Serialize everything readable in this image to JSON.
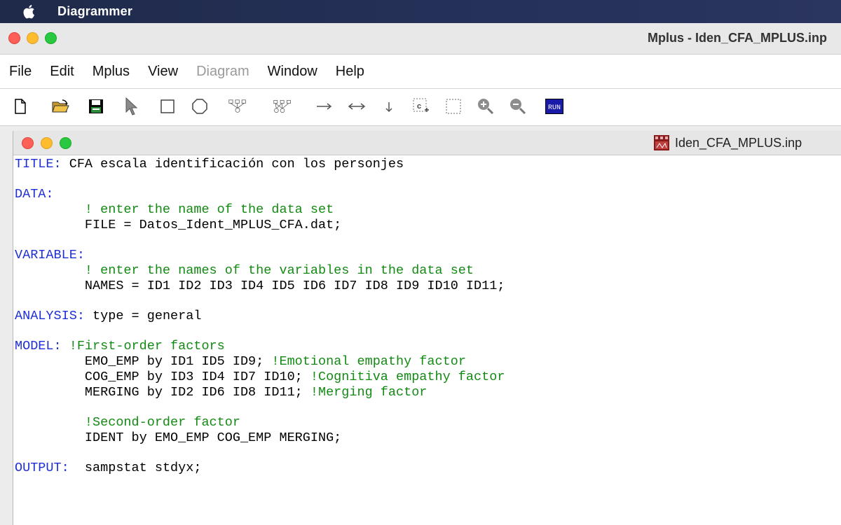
{
  "system_menubar": {
    "app_name": "Diagrammer"
  },
  "window": {
    "title": "Mplus - Iden_CFA_MPLUS.inp",
    "menu": [
      {
        "label": "File",
        "enabled": true
      },
      {
        "label": "Edit",
        "enabled": true
      },
      {
        "label": "Mplus",
        "enabled": true
      },
      {
        "label": "View",
        "enabled": true
      },
      {
        "label": "Diagram",
        "enabled": false
      },
      {
        "label": "Window",
        "enabled": true
      },
      {
        "label": "Help",
        "enabled": true
      }
    ],
    "toolbar": {
      "run_label": "RUN",
      "icons": [
        "new-file-icon",
        "open-folder-icon",
        "save-icon",
        "pointer-icon",
        "rectangle-icon",
        "circle-icon",
        "diagram-tree-icon",
        "diagram-cross-icon",
        "arrow-right-icon",
        "arrow-both-icon",
        "arrow-down-icon",
        "covariance-select-icon",
        "marquee-select-icon",
        "zoom-in-icon",
        "zoom-out-icon",
        "run-icon"
      ]
    }
  },
  "document": {
    "filename": "Iden_CFA_MPLUS.inp",
    "lines": [
      [
        {
          "t": "kw",
          "v": "TITLE:"
        },
        {
          "t": "tx",
          "v": " CFA escala identificación con los personjes"
        }
      ],
      [],
      [
        {
          "t": "kw",
          "v": "DATA:"
        }
      ],
      [
        {
          "t": "cm",
          "v": "         ! enter the name of the data set"
        }
      ],
      [
        {
          "t": "tx",
          "v": "         FILE = Datos_Ident_MPLUS_CFA.dat;"
        }
      ],
      [],
      [
        {
          "t": "kw",
          "v": "VARIABLE:"
        }
      ],
      [
        {
          "t": "cm",
          "v": "         ! enter the names of the variables in the data set"
        }
      ],
      [
        {
          "t": "tx",
          "v": "         NAMES = ID1 ID2 ID3 ID4 ID5 ID6 ID7 ID8 ID9 ID10 ID11;"
        }
      ],
      [],
      [
        {
          "t": "kw",
          "v": "ANALYSIS:"
        },
        {
          "t": "tx",
          "v": " type = general"
        }
      ],
      [],
      [
        {
          "t": "kw",
          "v": "MODEL:"
        },
        {
          "t": "cm",
          "v": " !First-order factors"
        }
      ],
      [
        {
          "t": "tx",
          "v": "         EMO_EMP by ID1 ID5 ID9; "
        },
        {
          "t": "cm",
          "v": "!Emotional empathy factor"
        }
      ],
      [
        {
          "t": "tx",
          "v": "         COG_EMP by ID3 ID4 ID7 ID10; "
        },
        {
          "t": "cm",
          "v": "!Cognitiva empathy factor"
        }
      ],
      [
        {
          "t": "tx",
          "v": "         MERGING by ID2 ID6 ID8 ID11; "
        },
        {
          "t": "cm",
          "v": "!Merging factor"
        }
      ],
      [],
      [
        {
          "t": "cm",
          "v": "         !Second-order factor"
        }
      ],
      [
        {
          "t": "tx",
          "v": "         IDENT by EMO_EMP COG_EMP MERGING;"
        }
      ],
      [],
      [
        {
          "t": "kw",
          "v": "OUTPUT:"
        },
        {
          "t": "tx",
          "v": "  sampstat stdyx;"
        }
      ]
    ]
  }
}
